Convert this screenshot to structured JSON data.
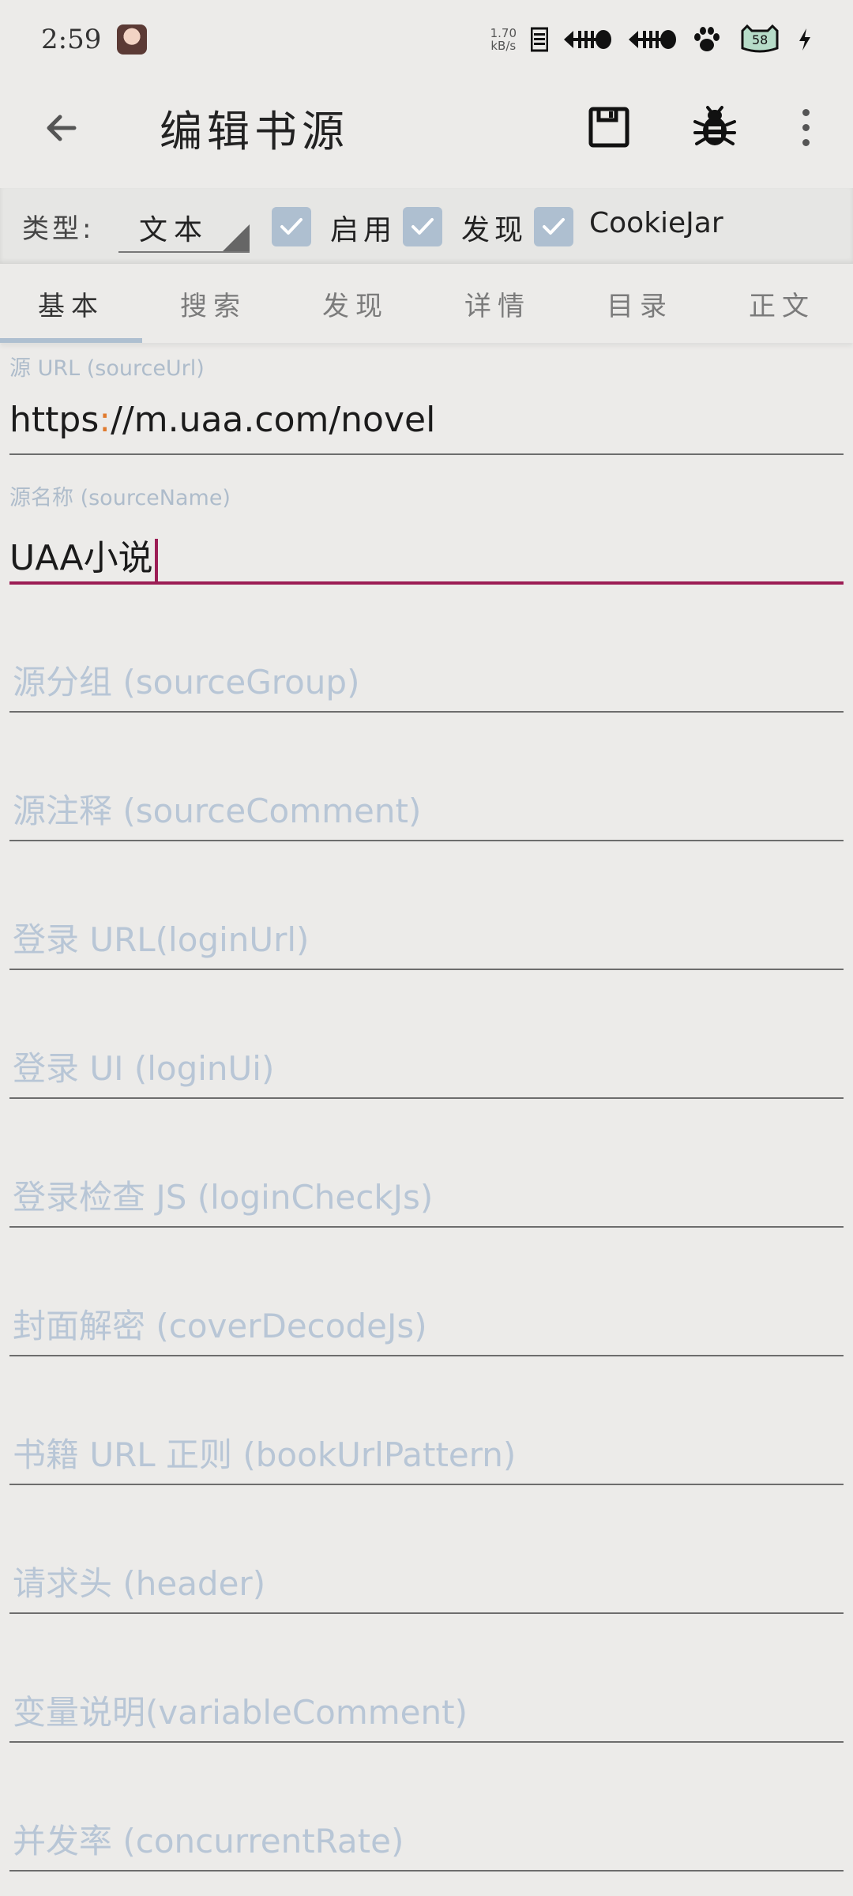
{
  "status": {
    "time": "2:59",
    "net_speed_value": "1.70",
    "net_speed_unit": "kB/s",
    "battery_level": "58"
  },
  "app_bar": {
    "title": "编辑书源",
    "icons": [
      "back-arrow-icon",
      "save-icon",
      "bug-icon",
      "more-vert-icon"
    ]
  },
  "options": {
    "type_label": "类型:",
    "type_value": "文本",
    "checkboxes": [
      {
        "label": "启用",
        "checked": true
      },
      {
        "label": "发现",
        "checked": true
      },
      {
        "label": "CookieJar",
        "checked": true
      }
    ],
    "checkbox_color": "#AEBFD0"
  },
  "tabs": [
    {
      "label": "基本",
      "active": true
    },
    {
      "label": "搜索",
      "active": false
    },
    {
      "label": "发现",
      "active": false
    },
    {
      "label": "详情",
      "active": false
    },
    {
      "label": "目录",
      "active": false
    },
    {
      "label": "正文",
      "active": false
    }
  ],
  "fields": {
    "source_url": {
      "label": "源 URL (sourceUrl)",
      "value_prefix": "https",
      "value_colon": ":",
      "value_suffix": "//m.uaa.com/novel"
    },
    "source_name": {
      "label": "源名称 (sourceName)",
      "value": "UAA小说"
    },
    "placeholders": [
      "源分组 (sourceGroup)",
      "源注释 (sourceComment)",
      "登录 URL(loginUrl)",
      "登录 UI (loginUi)",
      "登录检查 JS (loginCheckJs)",
      "封面解密 (coverDecodeJs)",
      "书籍 URL 正则 (bookUrlPattern)",
      "请求头 (header)",
      "变量说明(variableComment)",
      "并发率 (concurrentRate)"
    ]
  },
  "colors": {
    "accent": "#9C1D55",
    "hint": "#B8C6D6",
    "background": "#ECEBE9"
  }
}
